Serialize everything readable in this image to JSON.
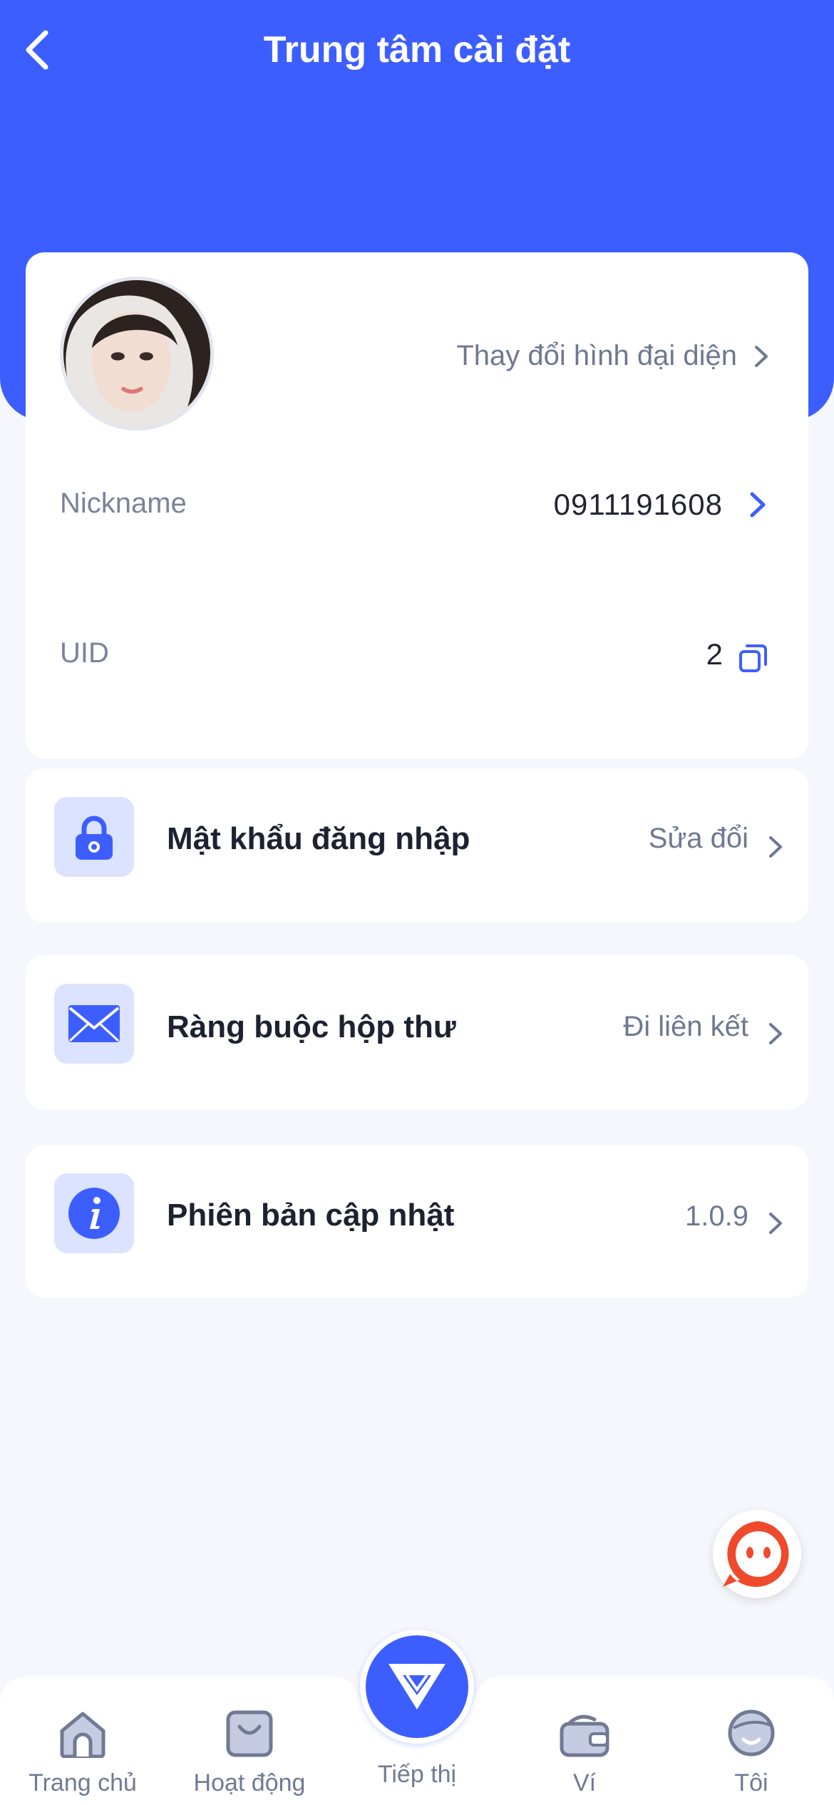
{
  "header": {
    "title": "Trung tâm cài đặt"
  },
  "profile": {
    "change_avatar_label": "Thay đổi hình đại diện",
    "nickname_label": "Nickname",
    "nickname_value": "0911191608",
    "uid_label": "UID",
    "uid_value": "2"
  },
  "settings": [
    {
      "title": "Mật khẩu đăng nhập",
      "value": "Sửa đổi",
      "icon": "lock-icon"
    },
    {
      "title": "Ràng buộc hộp thư",
      "value": "Đi liên kết",
      "icon": "mail-icon"
    },
    {
      "title": "Phiên bản cập nhật",
      "value": "1.0.9",
      "icon": "info-icon"
    }
  ],
  "tabbar": {
    "items": [
      {
        "label": "Trang chủ",
        "icon": "home-icon"
      },
      {
        "label": "Hoạt động",
        "icon": "bag-icon"
      },
      {
        "label": "Tiếp thị",
        "icon": "diamond-icon"
      },
      {
        "label": "Ví",
        "icon": "wallet-icon"
      },
      {
        "label": "Tôi",
        "icon": "profile-icon"
      }
    ]
  },
  "colors": {
    "primary": "#3d5eff",
    "background": "#f6f7fd",
    "icon_box": "#dbe3ff",
    "chat_accent": "#ef4a2c"
  }
}
